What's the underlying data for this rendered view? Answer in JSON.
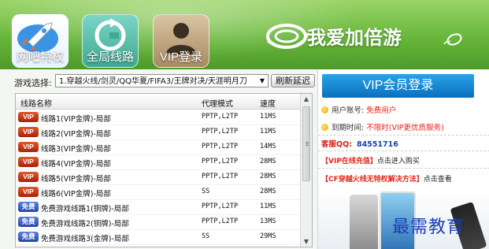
{
  "header": {
    "tabs": [
      {
        "label": "网吧特权",
        "icon": "rocket-icon"
      },
      {
        "label": "全局线路",
        "icon": "refresh-circle-icon"
      },
      {
        "label": "VIP登录",
        "icon": "user-silhouette-icon"
      }
    ],
    "brand": "我爱加倍游"
  },
  "toolbar": {
    "game_label": "游戏选择:",
    "game_selected": "1.穿越火线/剑灵/QQ华夏/FIFA3/王牌对决/天涯明月刀",
    "refresh_label": "刷新延迟"
  },
  "table": {
    "columns": [
      "线路名称",
      "代理模式",
      "速度"
    ],
    "rows": [
      {
        "badge": "VIP",
        "type": "vip",
        "name": "线路1(VIP金牌)-局部",
        "mode": "PPTP,L2TP",
        "speed": "11MS"
      },
      {
        "badge": "VIP",
        "type": "vip",
        "name": "线路2(VIP金牌)-局部",
        "mode": "PPTP,L2TP",
        "speed": "11MS"
      },
      {
        "badge": "VIP",
        "type": "vip",
        "name": "线路3(VIP金牌)-局部",
        "mode": "PPTP,L2TP",
        "speed": "14MS"
      },
      {
        "badge": "VIP",
        "type": "vip",
        "name": "线路4(VIP金牌)-局部",
        "mode": "PPTP,L2TP",
        "speed": "28MS"
      },
      {
        "badge": "VIP",
        "type": "vip",
        "name": "线路5(VIP金牌)-局部",
        "mode": "PPTP,L2TP",
        "speed": "28MS"
      },
      {
        "badge": "VIP",
        "type": "vip",
        "name": "线路6(VIP金牌)-局部",
        "mode": "SS",
        "speed": "28MS"
      },
      {
        "badge": "免费",
        "type": "free",
        "name": "免费游戏线路1(铜牌)-局部",
        "mode": "PPTP,L2TP",
        "speed": "11MS"
      },
      {
        "badge": "免费",
        "type": "free",
        "name": "免费游戏线路2(铜牌)-局部",
        "mode": "PPTP,L2TP",
        "speed": "13MS"
      },
      {
        "badge": "免费",
        "type": "free",
        "name": "免费游戏线路3(金牌)-局部",
        "mode": "SS",
        "speed": "29MS"
      }
    ]
  },
  "right": {
    "vip_login_label": "VIP会员登录",
    "account_label": "用户账号:",
    "account_value": "免费用户",
    "expire_label": "到期时间:",
    "expire_value": "不限时(VIP更优质服务)",
    "qq_label": "客服QQ:",
    "qq_value": "84551716",
    "promo1_hl": "【VIP在线充值】",
    "promo1_sub": "点击进入购买",
    "promo2_hl": "【CF穿越火线无特权解决方法】",
    "promo2_sub": "点击查看"
  },
  "watermark": "最需教育",
  "colors": {
    "header_green": "#67b63a",
    "vip_blue": "#0b6fbd",
    "accent_red": "#e3261b"
  }
}
